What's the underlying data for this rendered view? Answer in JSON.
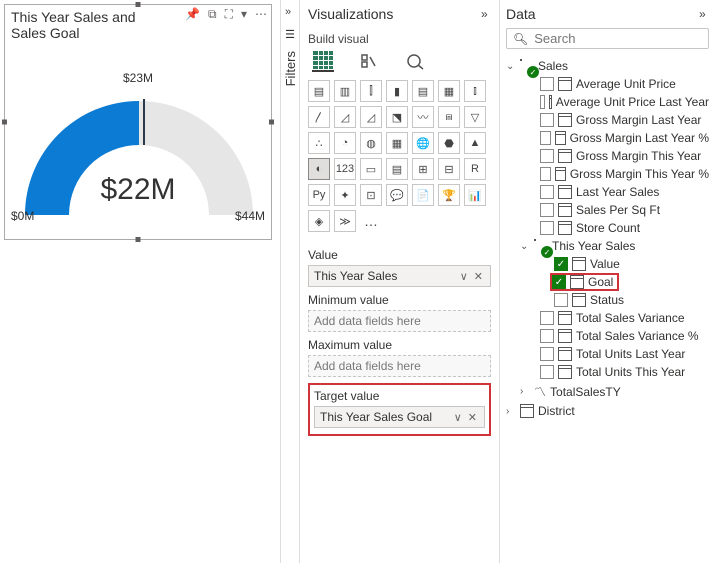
{
  "canvas": {
    "title": "This Year Sales and \nSales Goal",
    "gauge": {
      "target_label": "$23M",
      "value_label": "$22M",
      "min_label": "$0M",
      "max_label": "$44M"
    },
    "toolbar_icons": [
      "pin-icon",
      "copy-icon",
      "focus-icon",
      "filter-icon",
      "more-icon"
    ]
  },
  "filters": {
    "label": "Filters"
  },
  "viz": {
    "title": "Visualizations",
    "subtitle": "Build visual",
    "ellipsis": "…",
    "wells": {
      "value": {
        "label": "Value",
        "item": "This Year Sales"
      },
      "min": {
        "label": "Minimum value",
        "placeholder": "Add data fields here"
      },
      "max": {
        "label": "Maximum value",
        "placeholder": "Add data fields here"
      },
      "target": {
        "label": "Target value",
        "item": "This Year Sales Goal"
      }
    },
    "chart_icons": [
      "stacked-bar",
      "clustered-bar",
      "stacked-column",
      "clustered-column",
      "stacked-bar-100",
      "clustered-column-100",
      "line-column",
      "line",
      "area",
      "stacked-area",
      "line-column2",
      "ribbon",
      "waterfall",
      "funnel",
      "scatter",
      "pie",
      "donut",
      "treemap",
      "map",
      "filled-map",
      "azure-map",
      "gauge",
      "card",
      "kpi",
      "slicer",
      "table",
      "matrix",
      "r",
      "python",
      "key-influencers",
      "decomp",
      "qa",
      "narrative",
      "paginated",
      "power-apps",
      "power-automate"
    ]
  },
  "data": {
    "title": "Data",
    "search_placeholder": "Search",
    "tables": {
      "sales": {
        "name": "Sales",
        "fields": [
          "Average Unit Price",
          "Average Unit Price Last Year",
          "Gross Margin Last Year",
          "Gross Margin Last Year %",
          "Gross Margin This Year",
          "Gross Margin This Year %",
          "Last Year Sales",
          "Sales Per Sq Ft",
          "Store Count"
        ],
        "kpi": {
          "name": "This Year Sales",
          "children": [
            {
              "name": "Value",
              "checked": true
            },
            {
              "name": "Goal",
              "checked": true,
              "highlight": true
            },
            {
              "name": "Status",
              "checked": false
            }
          ]
        },
        "more_fields": [
          "Total Sales Variance",
          "Total Sales Variance %",
          "Total Units Last Year",
          "Total Units This Year"
        ],
        "trend_field": "TotalSalesTY"
      },
      "district": {
        "name": "District"
      }
    }
  },
  "icons": {
    "search": "🔍︎"
  }
}
